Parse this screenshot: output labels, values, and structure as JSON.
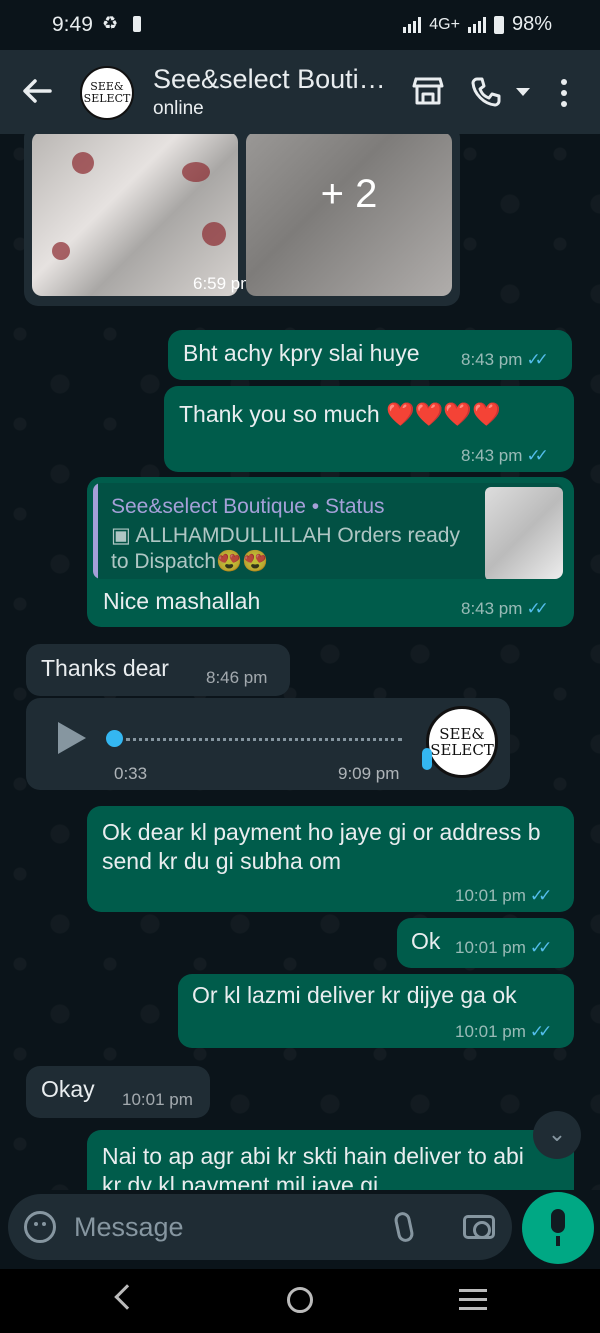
{
  "status_bar": {
    "time": "9:49",
    "sync_glyph": "♻",
    "network": "4G+",
    "battery": "98%"
  },
  "header": {
    "contact_name": "See&select Bouti…",
    "contact_status": "online",
    "avatar_line1": "SEE&",
    "avatar_line2": "SELECT"
  },
  "messages": {
    "image_group": {
      "more_count": "+ 2",
      "time": "6:59 pm"
    },
    "m1": {
      "text": "Bht achy kpry slai huye",
      "time": "8:43 pm"
    },
    "m2": {
      "text": "Thank you so much ❤️❤️❤️❤️",
      "time": "8:43 pm"
    },
    "m3": {
      "quote_title": "See&select Boutique • Status",
      "quote_body": "▣ ALLHAMDULLILLAH Orders ready to Dispatch😍😍",
      "text": "Nice mashallah",
      "time": "8:43 pm"
    },
    "m4": {
      "text": "Thanks dear",
      "time": "8:46 pm"
    },
    "voice": {
      "duration": "0:33",
      "time": "9:09 pm",
      "avatar_line1": "SEE&",
      "avatar_line2": "SELECT"
    },
    "m5": {
      "text": "Ok dear kl payment ho jaye gi or address b send kr du gi subha om",
      "time": "10:01 pm"
    },
    "m6": {
      "text": "Ok",
      "time": "10:01 pm"
    },
    "m7": {
      "text": "Or kl lazmi deliver kr dijye ga ok",
      "time": "10:01 pm"
    },
    "m8": {
      "text": "Okay",
      "time": "10:01 pm"
    },
    "m9": {
      "text": "Nai to ap agr abi kr skti hain deliver to abi kr dy kl payment mil jaye gi"
    }
  },
  "ticks_glyph": "✓✓",
  "composer": {
    "placeholder": "Message"
  },
  "colors": {
    "outgoing": "#005c4b",
    "incoming": "#1f2c34",
    "accent": "#00a884",
    "read_ticks": "#53bdeb"
  }
}
